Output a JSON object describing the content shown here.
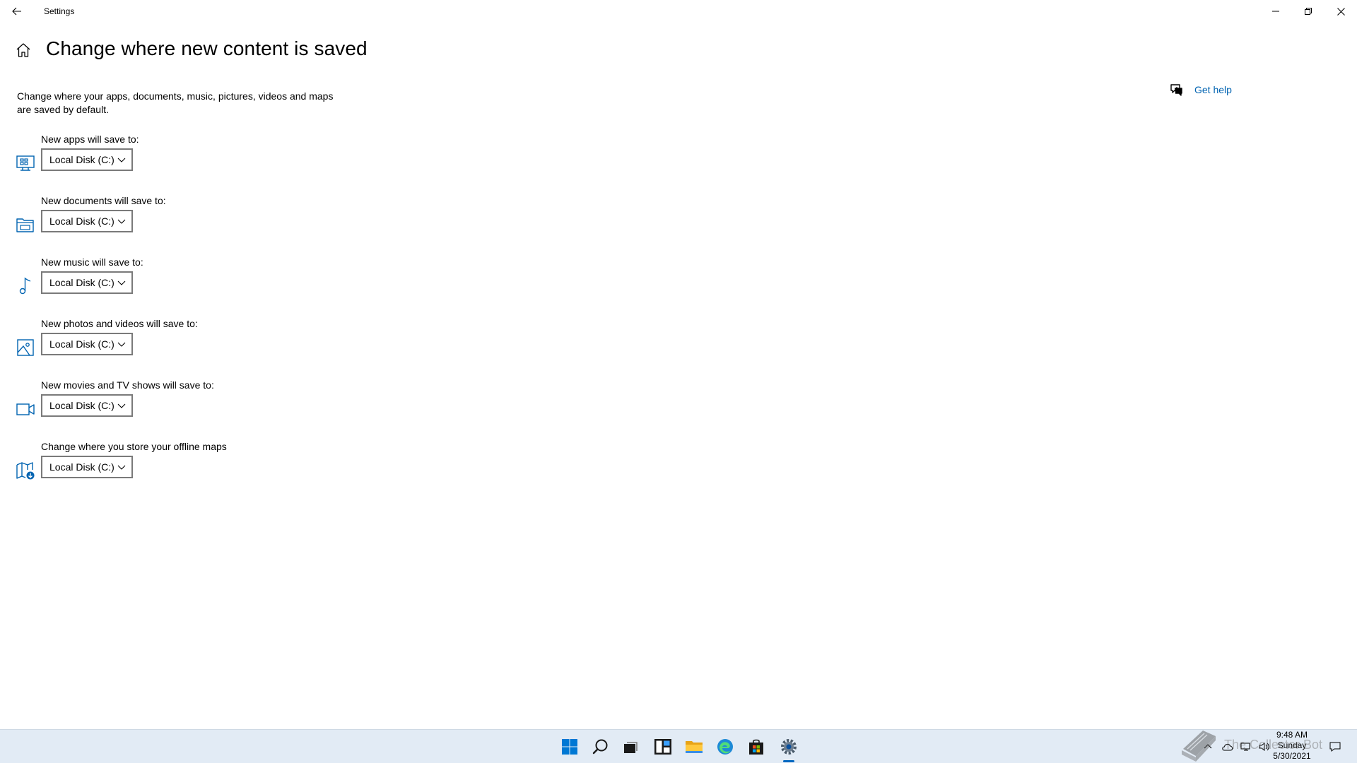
{
  "window": {
    "title": "Settings"
  },
  "header": {
    "title": "Change where new content is saved"
  },
  "description": "Change where your apps, documents, music, pictures, videos and maps are saved by default.",
  "help": {
    "label": "Get help"
  },
  "settings": [
    {
      "label": "New apps will save to:",
      "value": "Local Disk (C:)",
      "icon": "apps-monitor-icon"
    },
    {
      "label": "New documents will save to:",
      "value": "Local Disk (C:)",
      "icon": "folder-icon"
    },
    {
      "label": "New music will save to:",
      "value": "Local Disk (C:)",
      "icon": "music-note-icon"
    },
    {
      "label": "New photos and videos will save to:",
      "value": "Local Disk (C:)",
      "icon": "photo-icon"
    },
    {
      "label": "New movies and TV shows will save to:",
      "value": "Local Disk (C:)",
      "icon": "video-camera-icon"
    },
    {
      "label": "Change where you store your offline maps",
      "value": "Local Disk (C:)",
      "icon": "offline-map-icon"
    }
  ],
  "taskbar": {
    "apps": [
      "start-icon",
      "search-icon",
      "task-view-icon",
      "widgets-icon",
      "file-explorer-icon",
      "edge-icon",
      "store-icon",
      "settings-icon"
    ],
    "active_app": "settings-icon",
    "time": "9:48 AM",
    "day": "Sunday",
    "date": "5/30/2021"
  },
  "watermark": {
    "text": "The Collector Bot"
  },
  "colors": {
    "accent": "#0063b1",
    "taskbar_bg": "#e2ebf5",
    "dropdown_border": "#7a7a7a"
  }
}
